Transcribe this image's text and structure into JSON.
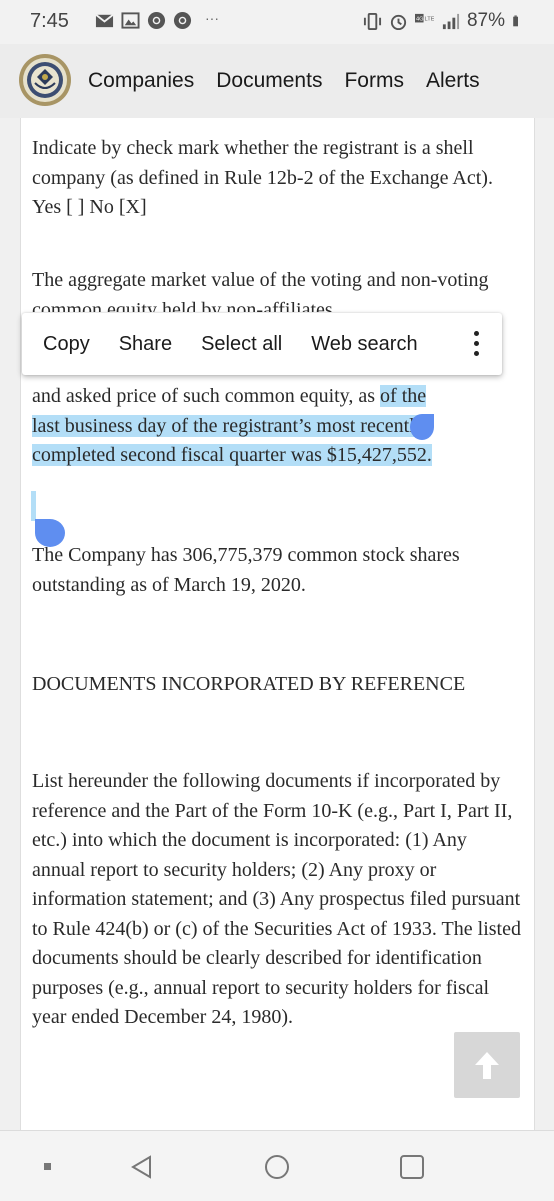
{
  "status_bar": {
    "time": "7:45",
    "more": "···",
    "battery": "87%",
    "icons": [
      "mail-icon",
      "image-icon",
      "chrome-icon",
      "chrome-icon",
      "vibrate-icon",
      "alarm-icon",
      "4g-lte-icon",
      "signal-icon",
      "battery-icon"
    ]
  },
  "nav": {
    "links": [
      "Companies",
      "Documents",
      "Forms",
      "Alerts"
    ]
  },
  "context_menu": {
    "items": [
      "Copy",
      "Share",
      "Select all",
      "Web search"
    ]
  },
  "document": {
    "p1": "Indicate by check mark whether the registrant is a shell company (as defined in Rule 12b-2 of the Exchange Act). Yes [  ] No [X]",
    "p2_visible_top": "The aggregate market value of the voting and non-voting common equity held by non-affiliates",
    "p2_line3": "and asked price of such common equity, as ",
    "p2_selected_a": "of the",
    "p2_selected_b": "last business day of the registrant’s most recently",
    "p2_selected_c": "completed second fiscal quarter was $15,427,552.",
    "p3": "The Company has 306,775,379 common stock shares outstanding as of March 19, 2020.",
    "p4": "DOCUMENTS INCORPORATED BY REFERENCE",
    "p5": "List hereunder the following documents if incorporated by reference and the Part of the Form 10-K (e.g., Part I, Part II, etc.) into which the document is incorporated: (1) Any annual report to security holders; (2) Any proxy or information statement; and (3) Any prospectus filed pursuant to Rule 424(b) or (c) of the Securities Act of 1933. The listed documents should be clearly described for identification purposes (e.g., annual report to security holders for fiscal year ended December 24, 1980)."
  },
  "colors": {
    "selection": "#b3def7",
    "handle": "#5f8ef0",
    "nav_bg": "#ececec"
  }
}
